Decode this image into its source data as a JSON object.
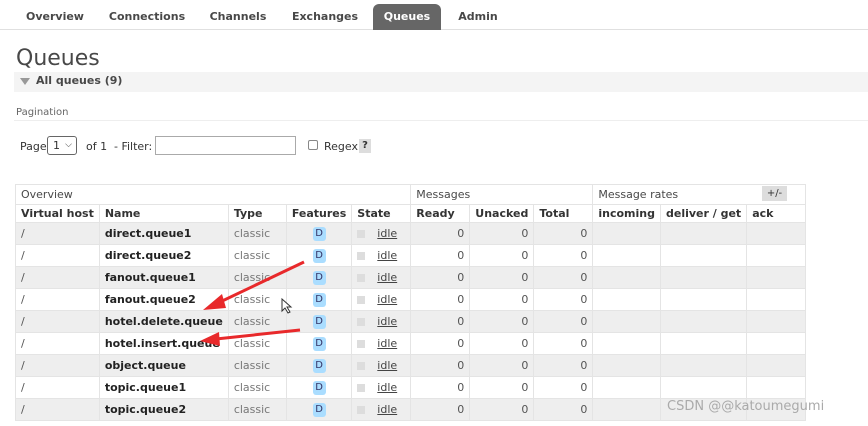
{
  "nav": {
    "tabs": [
      {
        "label": "Overview",
        "active": false
      },
      {
        "label": "Connections",
        "active": false
      },
      {
        "label": "Channels",
        "active": false
      },
      {
        "label": "Exchanges",
        "active": false
      },
      {
        "label": "Queues",
        "active": true
      },
      {
        "label": "Admin",
        "active": false
      }
    ]
  },
  "page": {
    "title": "Queues",
    "section_label": "All queues (9)"
  },
  "pagination": {
    "heading": "Pagination",
    "page_label": "Page",
    "page_value": "1",
    "of_label": "of 1",
    "filter_label": "- Filter:",
    "filter_value": "",
    "regex_label": "Regex",
    "help_label": "?"
  },
  "table": {
    "group_headers": [
      "Overview",
      "Messages",
      "Message rates"
    ],
    "columns_toggle": "+/-",
    "columns": [
      "Virtual host",
      "Name",
      "Type",
      "Features",
      "State",
      "Ready",
      "Unacked",
      "Total",
      "incoming",
      "deliver / get",
      "ack"
    ],
    "rows": [
      {
        "vhost": "/",
        "name": "direct.queue1",
        "type": "classic",
        "feature": "D",
        "state": "idle",
        "ready": "0",
        "unacked": "0",
        "total": "0"
      },
      {
        "vhost": "/",
        "name": "direct.queue2",
        "type": "classic",
        "feature": "D",
        "state": "idle",
        "ready": "0",
        "unacked": "0",
        "total": "0"
      },
      {
        "vhost": "/",
        "name": "fanout.queue1",
        "type": "classic",
        "feature": "D",
        "state": "idle",
        "ready": "0",
        "unacked": "0",
        "total": "0"
      },
      {
        "vhost": "/",
        "name": "fanout.queue2",
        "type": "classic",
        "feature": "D",
        "state": "idle",
        "ready": "0",
        "unacked": "0",
        "total": "0"
      },
      {
        "vhost": "/",
        "name": "hotel.delete.queue",
        "type": "classic",
        "feature": "D",
        "state": "idle",
        "ready": "0",
        "unacked": "0",
        "total": "0"
      },
      {
        "vhost": "/",
        "name": "hotel.insert.queue",
        "type": "classic",
        "feature": "D",
        "state": "idle",
        "ready": "0",
        "unacked": "0",
        "total": "0"
      },
      {
        "vhost": "/",
        "name": "object.queue",
        "type": "classic",
        "feature": "D",
        "state": "idle",
        "ready": "0",
        "unacked": "0",
        "total": "0"
      },
      {
        "vhost": "/",
        "name": "topic.queue1",
        "type": "classic",
        "feature": "D",
        "state": "idle",
        "ready": "0",
        "unacked": "0",
        "total": "0"
      },
      {
        "vhost": "/",
        "name": "topic.queue2",
        "type": "classic",
        "feature": "D",
        "state": "idle",
        "ready": "0",
        "unacked": "0",
        "total": "0"
      }
    ]
  },
  "watermark": "CSDN @@katoumegumi",
  "colors": {
    "active_tab": "#666666",
    "feature_badge": "#aaddff",
    "annotation_arrow": "#e8292b"
  }
}
